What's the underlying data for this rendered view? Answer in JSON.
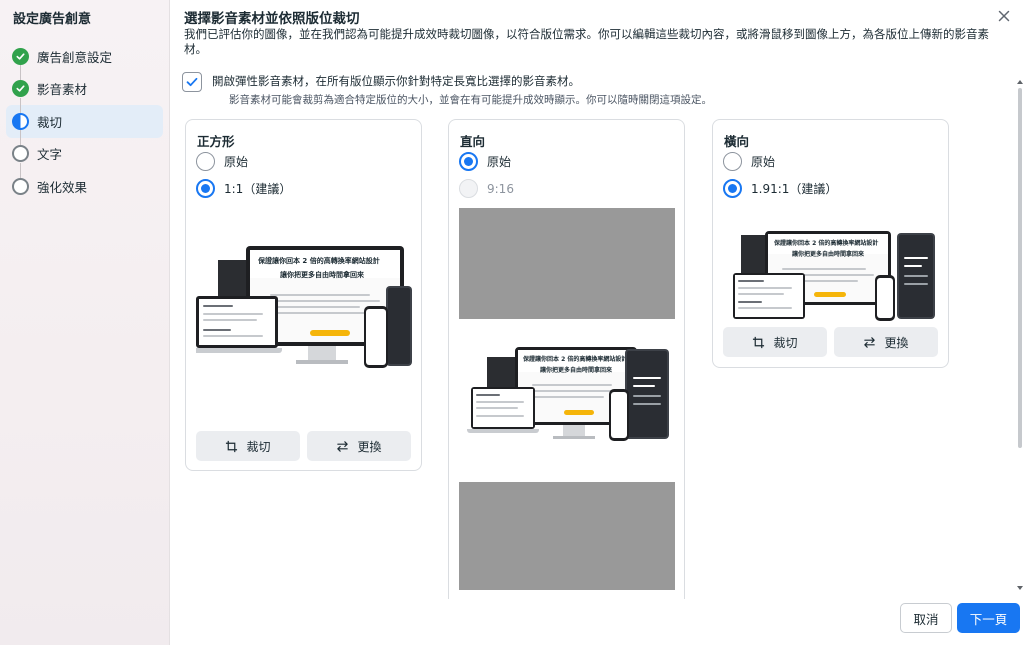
{
  "sidebar": {
    "title": "設定廣告創意",
    "steps": [
      {
        "label": "廣告創意設定",
        "status": "done"
      },
      {
        "label": "影音素材",
        "status": "done"
      },
      {
        "label": "裁切",
        "status": "current"
      },
      {
        "label": "文字",
        "status": "todo"
      },
      {
        "label": "強化效果",
        "status": "todo"
      }
    ]
  },
  "main": {
    "heading": "選擇影音素材並依照版位裁切",
    "description": "我們已評估你的圖像，並在我們認為可能提升成效時裁切圖像，以符合版位需求。你可以編輯這些裁切內容，或將滑鼠移到圖像上方，為各版位上傳新的影音素材。",
    "flexible_checkbox": {
      "checked": true,
      "label": "開啟彈性影音素材，在所有版位顯示你針對特定長寬比選擇的影音素材。",
      "sublabel": "影音素材可能會裁剪為適合特定版位的大小，並會在有可能提升成效時顯示。你可以隨時關閉這項設定。"
    }
  },
  "cards": {
    "square": {
      "title": "正方形",
      "option_original": "原始",
      "option_recommended": "1:1（建議）",
      "crop_label": "裁切",
      "replace_label": "更換"
    },
    "vertical": {
      "title": "直向",
      "option_original": "原始",
      "option_ratio": "9:16"
    },
    "horizontal": {
      "title": "橫向",
      "option_original": "原始",
      "option_recommended": "1.91:1（建議）",
      "crop_label": "裁切",
      "replace_label": "更換"
    }
  },
  "mockup": {
    "headline": "保證讓你回本 2 倍的高轉換率網站設計",
    "subheadline": "讓你把更多自由時間拿回來"
  },
  "footer": {
    "cancel_label": "取消",
    "next_label": "下一頁"
  },
  "colors": {
    "accent": "#1877f2",
    "done": "#31a24c",
    "placeholder_gray": "#999999"
  }
}
